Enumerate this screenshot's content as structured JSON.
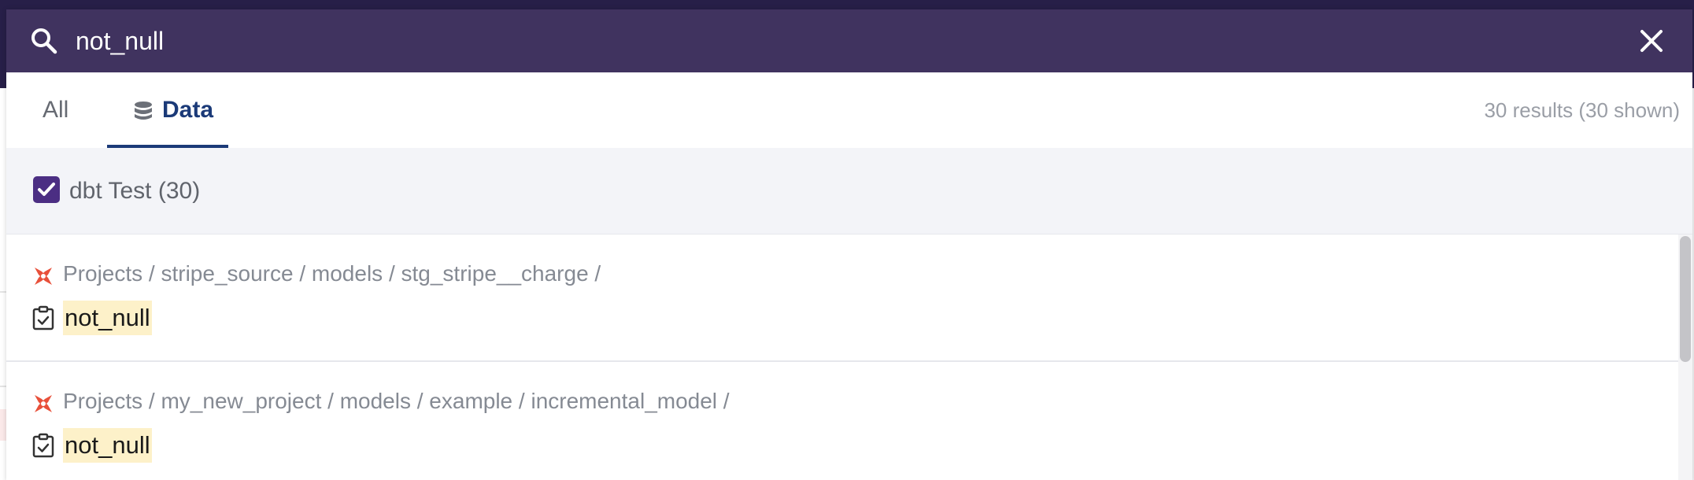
{
  "search": {
    "value": "not_null"
  },
  "tabs": [
    {
      "label": "All"
    },
    {
      "label": "Data"
    }
  ],
  "results_count": "30 results (30 shown)",
  "filter": {
    "label": "dbt Test (30)",
    "checked": true
  },
  "results": [
    {
      "breadcrumb": "Projects / stripe_source / models / stg_stripe__charge /",
      "name": "not_null"
    },
    {
      "breadcrumb": "Projects / my_new_project / models / example / incremental_model /",
      "name": "not_null"
    }
  ],
  "icons": {
    "search": "search-icon",
    "close": "close-icon",
    "database": "database-icon",
    "dbt": "dbt-logo-icon",
    "test": "clipboard-check-icon",
    "checkbox": "checkmark-icon"
  },
  "colors": {
    "search_bar": "#40335f",
    "accent": "#1b3a78",
    "checkbox": "#4b2e83",
    "highlight": "#fdf1c9",
    "dbt_orange": "#e8503a"
  }
}
